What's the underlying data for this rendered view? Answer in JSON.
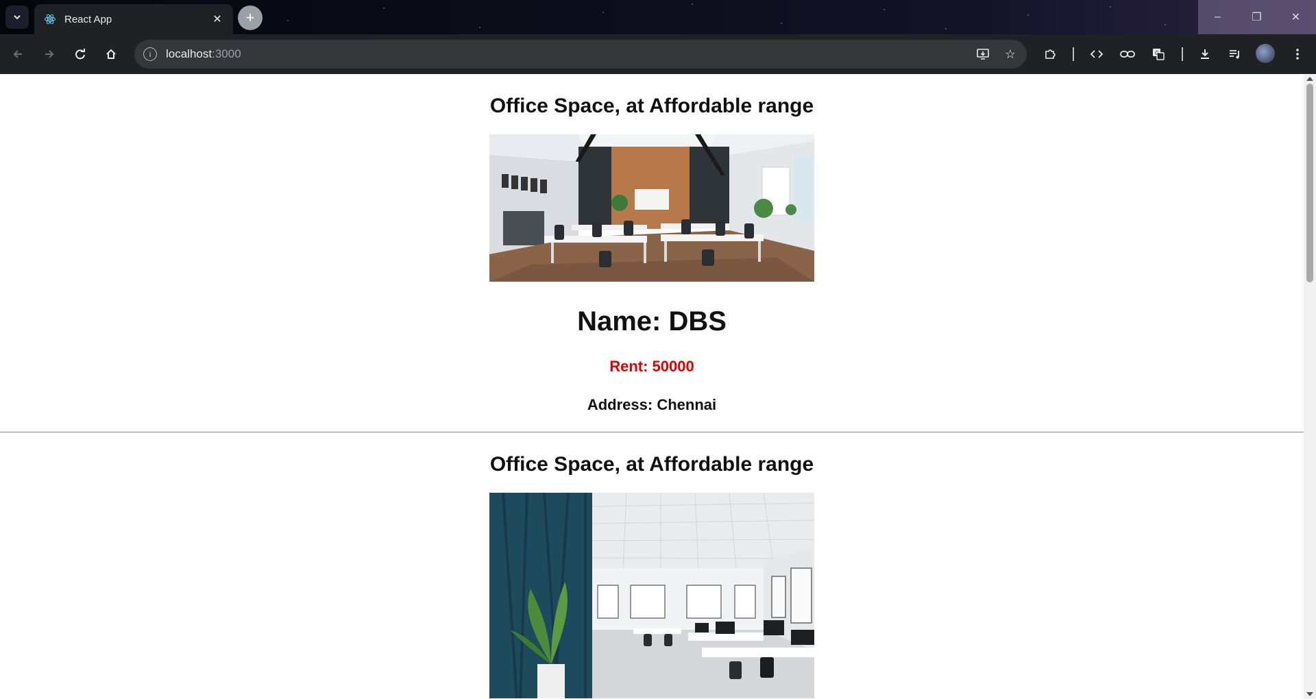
{
  "browser": {
    "tab": {
      "title": "React App",
      "favicon": "react-icon"
    },
    "address_bar": {
      "host": "localhost",
      "port": ":3000"
    }
  },
  "listings": [
    {
      "heading": "Office Space, at Affordable range",
      "image_alt": "Modern office with white desks and wooden wall",
      "name": "Name: DBS",
      "rent": "Rent: 50000",
      "address": "Address: Chennai"
    },
    {
      "heading": "Office Space, at Affordable range",
      "image_alt": "Bright open office with blue panel wall and plant"
    }
  ],
  "colors": {
    "rent": "#e00000",
    "chrome": "#202124",
    "omnibox": "#35363a"
  }
}
